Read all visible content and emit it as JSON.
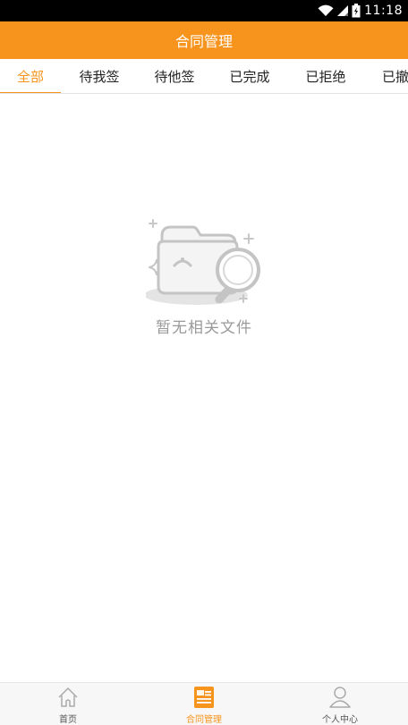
{
  "status_bar": {
    "time": "11:18",
    "icons": [
      "wifi-icon",
      "signal-icon",
      "battery-icon"
    ]
  },
  "header": {
    "title": "合同管理"
  },
  "tabs": [
    {
      "label": "全部",
      "active": true
    },
    {
      "label": "待我签",
      "active": false
    },
    {
      "label": "待他签",
      "active": false
    },
    {
      "label": "已完成",
      "active": false
    },
    {
      "label": "已拒绝",
      "active": false
    },
    {
      "label": "已撤",
      "active": false
    }
  ],
  "empty_state": {
    "icon": "empty-folder-search-icon",
    "message": "暂无相关文件"
  },
  "bottom_nav": [
    {
      "label": "首页",
      "icon": "home-icon",
      "active": false
    },
    {
      "label": "合同管理",
      "icon": "contract-icon",
      "active": true
    },
    {
      "label": "个人中心",
      "icon": "user-icon",
      "active": false
    }
  ],
  "colors": {
    "accent": "#f7941d",
    "status_bar": "#000000",
    "empty_text": "#9a9a9a",
    "nav_background": "#f7f7f7"
  }
}
